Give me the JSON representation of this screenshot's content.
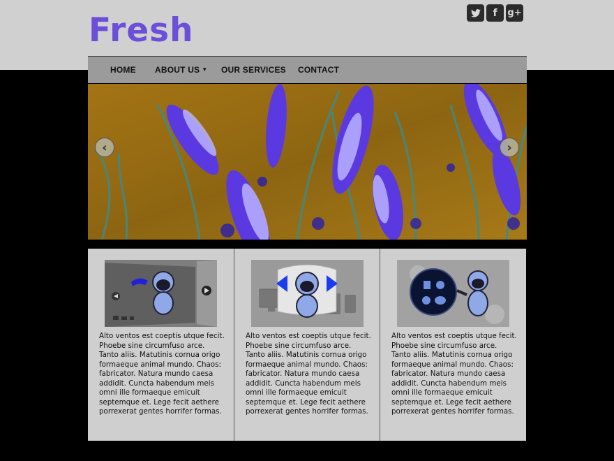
{
  "site": {
    "logo": "Fresh"
  },
  "social": [
    {
      "name": "twitter",
      "glyph": "🐦",
      "icon": "twitter-icon"
    },
    {
      "name": "facebook",
      "glyph": "f",
      "icon": "facebook-icon"
    },
    {
      "name": "google-plus",
      "glyph": "g+",
      "icon": "google-plus-icon"
    }
  ],
  "nav": {
    "home": "HOME",
    "about": "ABOUT US",
    "services": "OUR SERVICES",
    "contact": "CONTACT"
  },
  "slider": {
    "prev": "‹",
    "next": "›"
  },
  "columns": [
    {
      "text": "Alto ventos est coeptis utque fecit. Phoebe sine circumfuso arce. Tanto aliis. Matutinis cornua origo formaeque animal mundo. Chaos: fabricator. Natura mundo caesa addidit. Cuncta habendum meis omni ille formaeque emicuit septemque et. Lege fecit aethere porrexerat gentes horrifer formas."
    },
    {
      "text": "Alto ventos est coeptis utque fecit. Phoebe sine circumfuso arce. Tanto aliis. Matutinis cornua origo formaeque animal mundo. Chaos: fabricator. Natura mundo caesa addidit. Cuncta habendum meis omni ille formaeque emicuit septemque et. Lege fecit aethere porrexerat gentes horrifer formas."
    },
    {
      "text": "Alto ventos est coeptis utque fecit. Phoebe sine circumfuso arce. Tanto aliis. Matutinis cornua origo formaeque animal mundo. Chaos: fabricator. Natura mundo caesa addidit. Cuncta habendum meis omni ille formaeque emicuit septemque et. Lege fecit aethere porrexerat gentes horrifer formas."
    }
  ],
  "colors": {
    "logo": "#6b4fd8",
    "nav": "#9b9b9b",
    "content": "#cfcfcf"
  }
}
